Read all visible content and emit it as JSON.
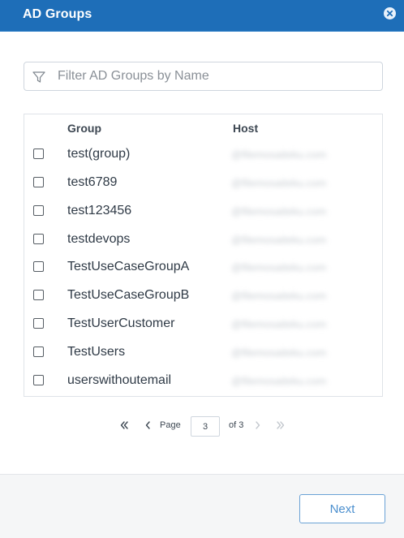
{
  "dialog": {
    "title": "AD Groups",
    "close_icon": "close-icon"
  },
  "filter": {
    "placeholder": "Filter AD Groups by Name",
    "value": "",
    "icon": "filter-icon"
  },
  "table": {
    "columns": {
      "group": "Group",
      "host": "Host"
    },
    "rows": [
      {
        "group": "test(group)",
        "host": "@filemosaiteku.com",
        "checked": false
      },
      {
        "group": "test6789",
        "host": "@filemosaiteku.com",
        "checked": false
      },
      {
        "group": "test123456",
        "host": "@filemosaiteku.com",
        "checked": false
      },
      {
        "group": "testdevops",
        "host": "@filemosaiteku.com",
        "checked": false
      },
      {
        "group": "TestUseCaseGroupA",
        "host": "@filemosaiteku.com",
        "checked": false
      },
      {
        "group": "TestUseCaseGroupB",
        "host": "@filemosaiteku.com",
        "checked": false
      },
      {
        "group": "TestUserCustomer",
        "host": "@filemosaiteku.com",
        "checked": false
      },
      {
        "group": "TestUsers",
        "host": "@filemosaiteku.com",
        "checked": false
      },
      {
        "group": "userswithoutemail",
        "host": "@filemosaiteku.com",
        "checked": false
      }
    ]
  },
  "pagination": {
    "page_label": "Page",
    "current_page": "3",
    "of_label": "of 3",
    "first_icon": "double-chevron-left-icon",
    "prev_icon": "chevron-left-icon",
    "next_icon": "chevron-right-icon",
    "last_icon": "double-chevron-right-icon"
  },
  "footer": {
    "next_label": "Next"
  },
  "colors": {
    "header_bg": "#1e6eb8",
    "text": "#2f3a46",
    "accent": "#4b8fce",
    "disabled": "#c3c8ce"
  }
}
